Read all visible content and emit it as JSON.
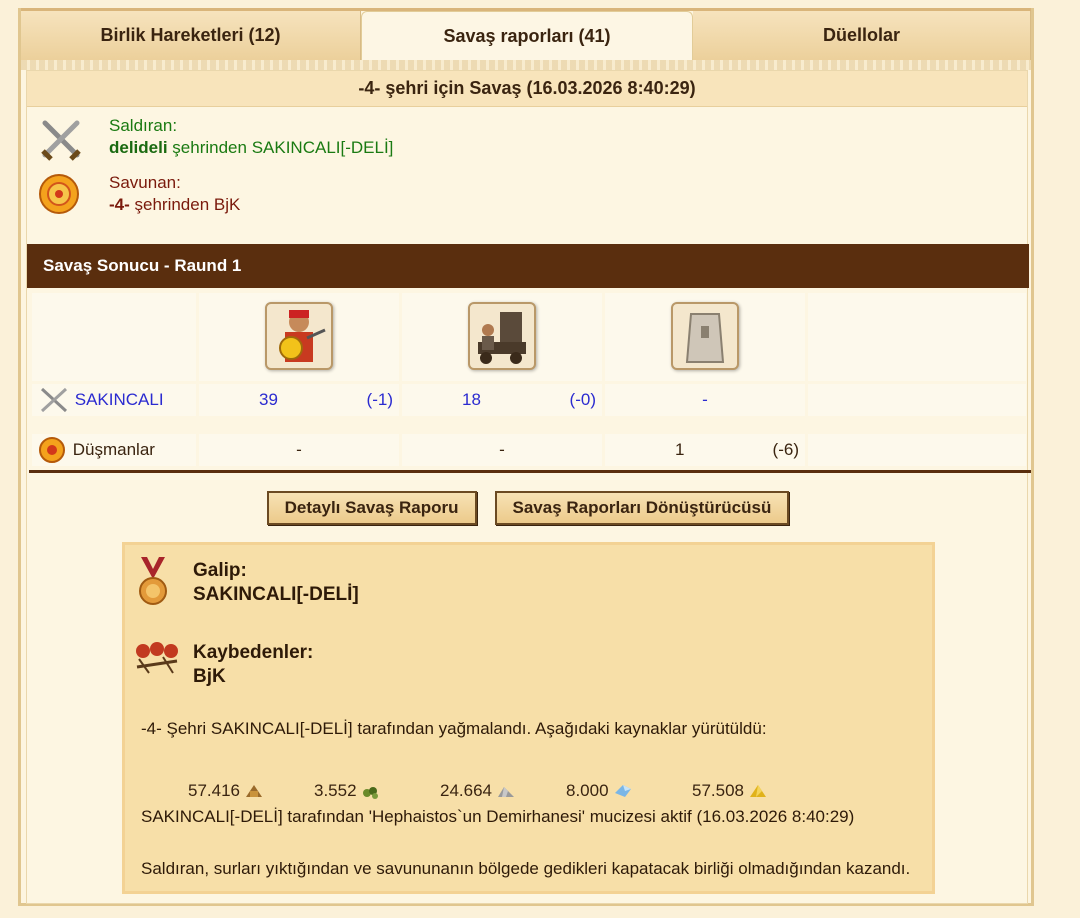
{
  "tabs": [
    {
      "label": "Birlik Hareketleri (12)"
    },
    {
      "label": "Savaş raporları (41)"
    },
    {
      "label": "Düellolar"
    }
  ],
  "report": {
    "title": "-4- şehri için Savaş (16.03.2026 8:40:29)",
    "attacker": {
      "label": "Saldıran:",
      "city": "delideli",
      "rest": " şehrinden SAKINCALI[-DELİ]"
    },
    "defender": {
      "label": "Savunan:",
      "city": "-4-",
      "rest": " şehrinden BjK"
    },
    "round_title": "Savaş Sonucu - Raund 1",
    "rows": [
      {
        "name": "SAKINCALI",
        "cells": [
          {
            "value": "39",
            "loss": "(-1)"
          },
          {
            "value": "18",
            "loss": "(-0)"
          },
          {
            "value": "-",
            "loss": ""
          }
        ]
      },
      {
        "name": "Düşmanlar",
        "cells": [
          {
            "value": "-",
            "loss": ""
          },
          {
            "value": "-",
            "loss": ""
          },
          {
            "value": "1",
            "loss": "(-6)"
          }
        ]
      }
    ],
    "buttons": {
      "detailed": "Detaylı Savaş Raporu",
      "converter": "Savaş Raporları Dönüştürücüsü"
    },
    "result": {
      "winner_label": "Galip:",
      "winner": "SAKINCALI[-DELİ]",
      "losers_label": "Kaybedenler:",
      "losers": "BjK",
      "plunder_text": "-4- Şehri SAKINCALI[-DELİ] tarafından yağmalandı. Aşağıdaki kaynaklar yürütüldü:",
      "resources": [
        {
          "amount": "57.416",
          "icon": "wood-icon"
        },
        {
          "amount": "3.552",
          "icon": "wine-icon"
        },
        {
          "amount": "24.664",
          "icon": "marble-icon"
        },
        {
          "amount": "8.000",
          "icon": "crystal-icon"
        },
        {
          "amount": "57.508",
          "icon": "sulfur-icon"
        }
      ],
      "wonder_text": "SAKINCALI[-DELİ] tarafından 'Hephaistos`un Demirhanesi' mucizesi aktif (16.03.2026 8:40:29)",
      "reason_text": "Saldıran, surları yıktığından ve savununanın bölgede gedikleri kapatacak birliği olmadığından kazandı."
    }
  }
}
